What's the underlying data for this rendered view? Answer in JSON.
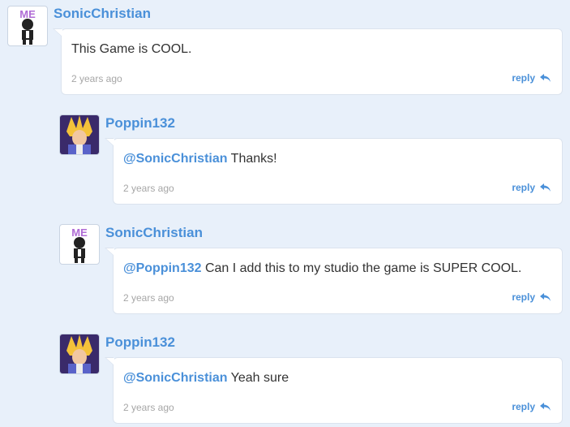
{
  "comments": [
    {
      "username": "SonicChristian",
      "mention": "",
      "text": "This Game is COOL.",
      "time": "2 years ago",
      "reply_label": "reply",
      "avatar": "me-robot-avatar"
    },
    {
      "username": "Poppin132",
      "mention": "@SonicChristian",
      "text": " Thanks!",
      "time": "2 years ago",
      "reply_label": "reply",
      "avatar": "anime-character-avatar"
    },
    {
      "username": "SonicChristian",
      "mention": "@Poppin132",
      "text": " Can I add this to my studio the game is SUPER COOL.",
      "time": "2 years ago",
      "reply_label": "reply",
      "avatar": "me-robot-avatar"
    },
    {
      "username": "Poppin132",
      "mention": "@SonicChristian",
      "text": " Yeah sure",
      "time": "2 years ago",
      "reply_label": "reply",
      "avatar": "anime-character-avatar"
    }
  ],
  "avatar_colors": {
    "me_text": "#b06cd6",
    "robot_body": "#222222",
    "anime_bg": "#3a2a6a",
    "anime_hair": "#f4c23a",
    "anime_armor": "#5a63c9"
  },
  "accent_color": "#4a90d9"
}
